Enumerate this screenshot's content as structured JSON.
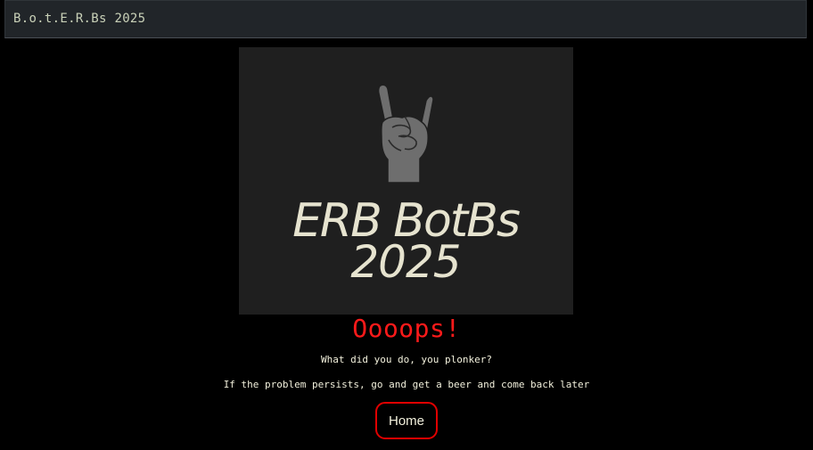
{
  "navbar": {
    "brand": "B.o.t.E.R.Bs 2025"
  },
  "logo": {
    "icon": "rock-hand-icon",
    "line1": "ERB BotBs",
    "line2": "2025"
  },
  "error": {
    "title": "Oooops!",
    "message": "What did you do, you plonker?",
    "hint": "If the problem persists, go and get a beer and come back later",
    "button_label": "Home"
  },
  "colors": {
    "background": "#000000",
    "navbar": "#212529",
    "title": "#ff1a1a",
    "button_border": "#e00000",
    "text": "#f2f0dc"
  }
}
